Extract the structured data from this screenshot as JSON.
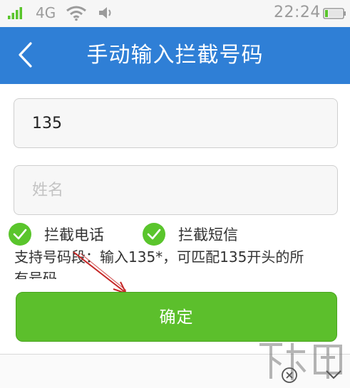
{
  "status_bar": {
    "network": "4G",
    "time": "22:24",
    "icons": [
      "signal-icon",
      "wifi-icon",
      "volume-icon",
      "battery-icon"
    ]
  },
  "header": {
    "title": "手动输入拦截号码",
    "back_icon": "chevron-left-icon",
    "background": "#2f7fd6"
  },
  "form": {
    "phone_value": "135",
    "phone_placeholder": "",
    "name_value": "",
    "name_placeholder": "姓名",
    "options": [
      {
        "label": "拦截电话",
        "checked": true
      },
      {
        "label": "拦截短信",
        "checked": true
      }
    ],
    "hint_line1": "支持号码段：输入135*，可匹配135开头的所",
    "hint_line2": "有号码",
    "confirm_label": "确定",
    "accent": "#5cbf2c"
  },
  "watermark": {
    "icon": "xiazaiba-logo"
  },
  "bottom_bar": {
    "icons": [
      "close-circle-icon",
      "chevron-down-icon"
    ]
  }
}
